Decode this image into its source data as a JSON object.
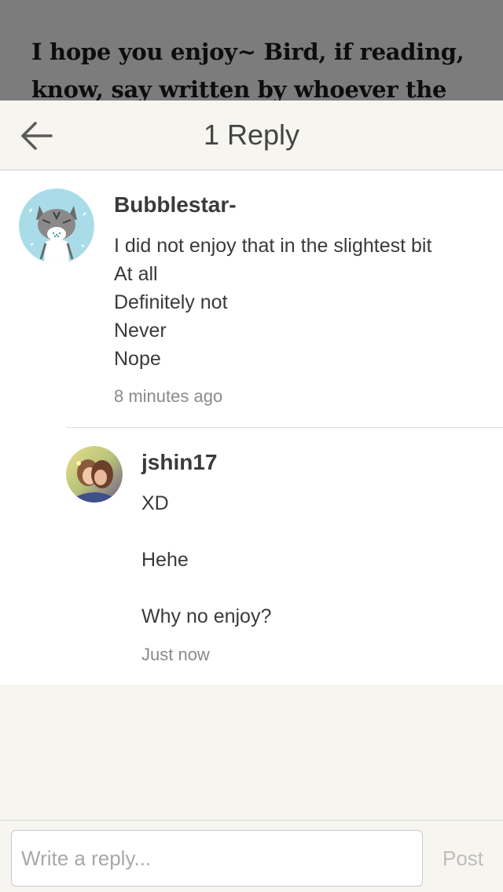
{
  "background_post": {
    "lines": [
      "I hope you enjoy~ Bird, if reading,",
      "know, say written by whoever the two"
    ]
  },
  "header": {
    "back_icon": "arrow-left-icon",
    "title": "1 Reply"
  },
  "comment": {
    "author": "Bubblestar-",
    "avatar_icon": "cat-avatar",
    "lines": [
      "I did not enjoy that in the slightest bit",
      "At all",
      "Definitely not",
      "Never",
      "Nope"
    ],
    "time": "8 minutes ago"
  },
  "reply": {
    "author": "jshin17",
    "avatar_icon": "anime-avatar",
    "lines": [
      "XD",
      "",
      "Hehe",
      "",
      "Why no enjoy?"
    ],
    "time": "Just now"
  },
  "composer": {
    "placeholder": "Write a reply...",
    "post_label": "Post"
  },
  "colors": {
    "overlay": "#7c7c7c",
    "page_bg": "#f6f5f0",
    "panel_bg": "#ffffff",
    "text": "#3a3a3a",
    "muted": "#8a8a8a",
    "post_disabled": "#bdbdbd"
  }
}
